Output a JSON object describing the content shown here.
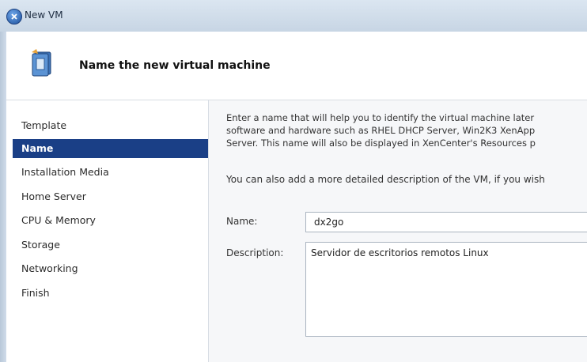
{
  "window": {
    "title": "New VM"
  },
  "header": {
    "title": "Name the new virtual machine"
  },
  "sidebar": {
    "items": [
      {
        "label": "Template"
      },
      {
        "label": "Name"
      },
      {
        "label": "Installation Media"
      },
      {
        "label": "Home Server"
      },
      {
        "label": "CPU & Memory"
      },
      {
        "label": "Storage"
      },
      {
        "label": "Networking"
      },
      {
        "label": "Finish"
      }
    ],
    "active_item": "Name"
  },
  "main": {
    "intro_lines": [
      "Enter a name that will help you to identify the virtual machine later",
      "software and hardware such as RHEL DHCP Server, Win2K3 XenApp",
      "Server. This name will also be displayed in XenCenter's Resources p"
    ],
    "description_hint": "You can also add a more detailed description of the VM, if you wish",
    "name_label": "Name:",
    "name_value": "dx2go",
    "description_label": "Description:",
    "description_value": "Servidor de escritorios remotos Linux"
  },
  "colors": {
    "accent": "#1a3f86",
    "titlebar": "#c7d5e4"
  },
  "icons": {
    "app": "new-vm-icon",
    "wizard": "wizard-page-icon"
  }
}
